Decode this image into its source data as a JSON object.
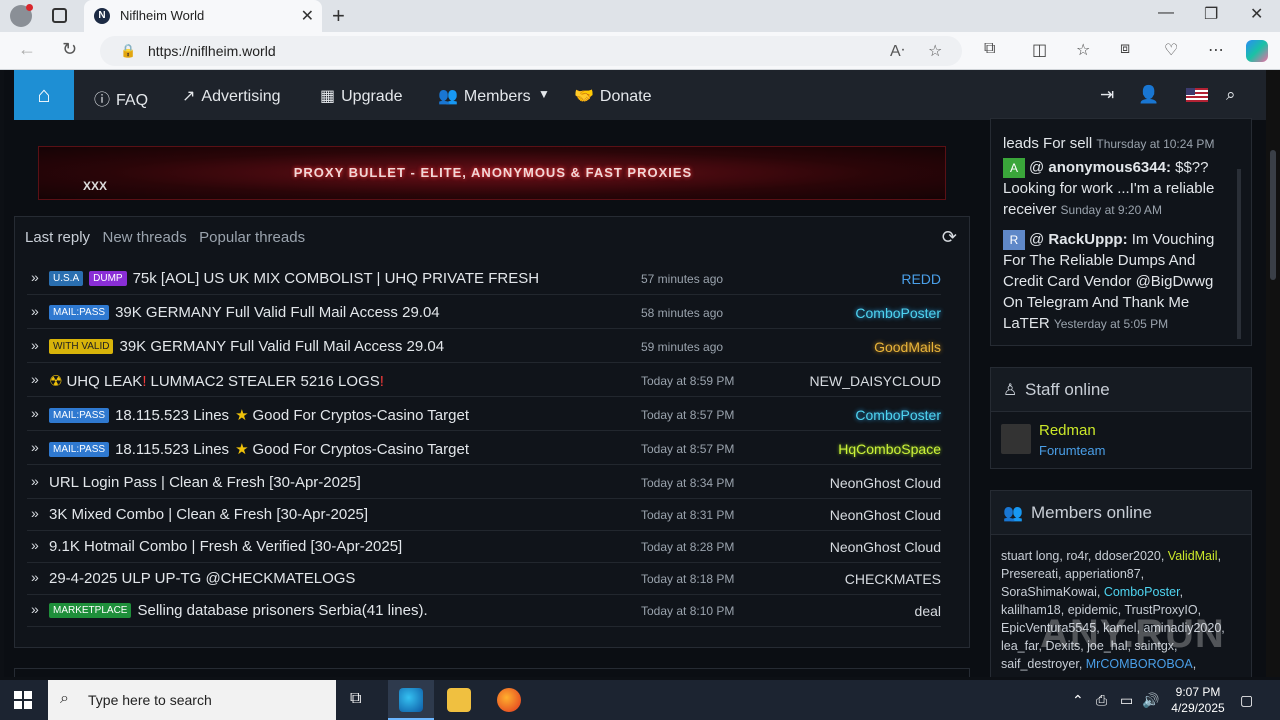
{
  "browser": {
    "tab_title": "Niflheim World",
    "tab_favicon": "N",
    "url": "https://niflheim.world"
  },
  "nav": {
    "faq": "FAQ",
    "advertising": "Advertising",
    "upgrade": "Upgrade",
    "members": "Members",
    "donate": "Donate"
  },
  "banner": {
    "text": "PROXY BULLET - ELITE, ANONYMOUS & FAST PROXIES",
    "sub": "XXX"
  },
  "threads": {
    "tabs": [
      "Last reply",
      "New threads",
      "Popular threads"
    ],
    "rows": [
      {
        "badges": [
          "U.S.A",
          "DUMP"
        ],
        "title": "75k [AOL] US UK MIX COMBOLIST | UHQ PRIVATE FRESH",
        "time": "57 minutes ago",
        "author": "REDD"
      },
      {
        "badges": [
          "MAIL:PASS"
        ],
        "title": "39K GERMANY Full Valid Full Mail Access 29.04",
        "time": "58 minutes ago",
        "author": "ComboPoster"
      },
      {
        "badges": [
          "WITH VALID"
        ],
        "title": "39K GERMANY Full Valid Full Mail Access 29.04",
        "time": "59 minutes ago",
        "author": "GoodMails"
      },
      {
        "badges": [],
        "prefix": "☢",
        "title": "UHQ LEAK",
        "title_b": "LUMMAC2 STEALER 5216 LOGS",
        "time": "Today at 8:59 PM",
        "author": "NEW_DAISYCLOUD"
      },
      {
        "badges": [
          "MAIL:PASS"
        ],
        "title": "18.115.523 Lines",
        "title_b": "Good For Cryptos-Casino Target",
        "time": "Today at 8:57 PM",
        "author": "ComboPoster"
      },
      {
        "badges": [
          "MAIL:PASS"
        ],
        "title": "18.115.523 Lines",
        "title_b": "Good For Cryptos-Casino Target",
        "time": "Today at 8:57 PM",
        "author": "HqComboSpace"
      },
      {
        "badges": [],
        "title": "URL Login Pass | Clean & Fresh [30-Apr-2025]",
        "time": "Today at 8:34 PM",
        "author": "NeonGhost Cloud"
      },
      {
        "badges": [],
        "title": "3K Mixed Combo | Clean & Fresh [30-Apr-2025]",
        "time": "Today at 8:31 PM",
        "author": "NeonGhost Cloud"
      },
      {
        "badges": [],
        "title": "9.1K Hotmail Combo | Fresh & Verified [30-Apr-2025]",
        "time": "Today at 8:28 PM",
        "author": "NeonGhost Cloud"
      },
      {
        "badges": [],
        "title": "29-4-2025 ULP UP-TG @CHECKMATELOGS",
        "time": "Today at 8:18 PM",
        "author": "CHECKMATES"
      },
      {
        "badges": [
          "MARKETPLACE"
        ],
        "title": "Selling database prisoners Serbia(41 lines).",
        "time": "Today at 8:10 PM",
        "author": "deal"
      }
    ]
  },
  "chat": {
    "m0_text": "leads For sell",
    "m0_when": "Thursday at 10:24 PM",
    "m1_av": "A",
    "m1_user": "anonymous6344:",
    "m1_text": "$$?? Looking for work ...I'm a reliable receiver",
    "m1_when": "Sunday at 9:20 AM",
    "m2_av": "R",
    "m2_user": "RackUppp:",
    "m2_text": "Im Vouching For The Reliable Dumps And Credit Card Vendor @BigDwwg On Telegram And Thank Me LaTER",
    "m2_when": "Yesterday at 5:05 PM"
  },
  "staff": {
    "title": "Staff online",
    "name": "Redman",
    "role": "Forumteam"
  },
  "members_online": {
    "title": "Members online",
    "m1": "stuart long, ro4r, ddoser2020, ",
    "m2": "ValidMail",
    "m3": ", Presereati, apperiation87, SoraShimaKowai, ",
    "m4": "ComboPoster",
    "m5": ", kalilham18, epidemic, TrustProxyIO, EpicVentura5545, kamel, aminadiy2020, lea_far, Dexits, joe_hal, saintgx, saif_destroyer, ",
    "m6": "MrCOMBOROBOA",
    "m7": ","
  },
  "taskbar": {
    "search_placeholder": "Type here to search",
    "time": "9:07 PM",
    "date": "4/29/2025"
  },
  "watermark": "ANY.RUN",
  "colors": {
    "accent": "#1e8fd4",
    "nav_bg": "#1e232b",
    "page_bg": "#0b0e13"
  }
}
